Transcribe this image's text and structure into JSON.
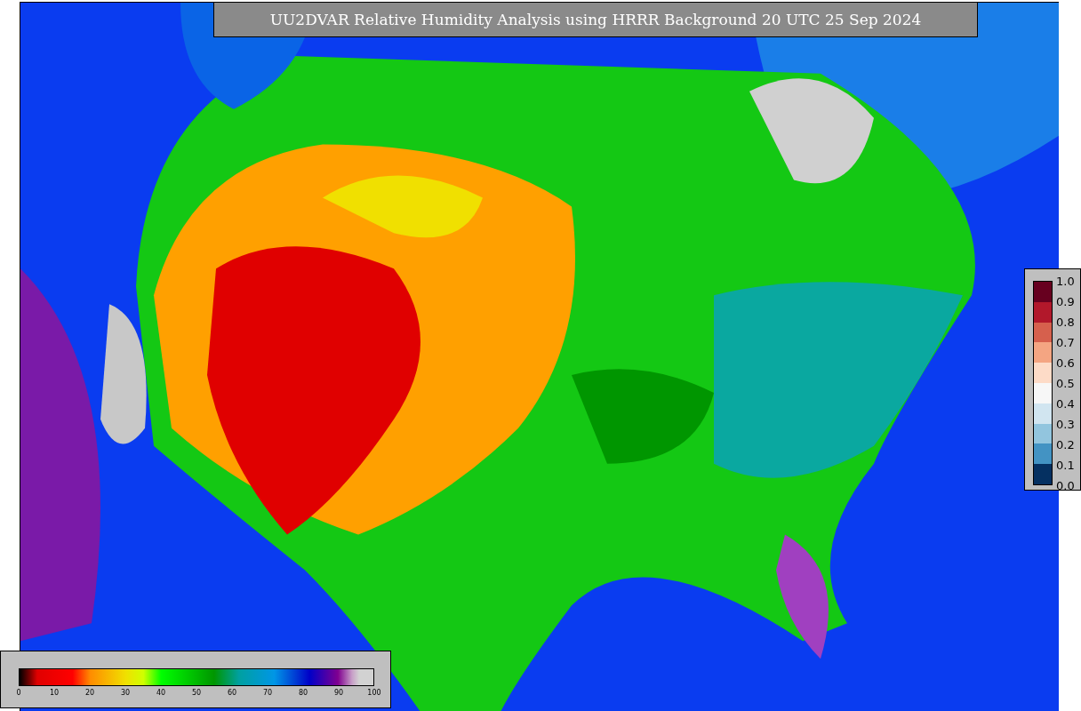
{
  "title": "UU2DVAR Relative Humidity Analysis using HRRR Background 20 UTC 25 Sep 2024",
  "quality_legend": {
    "ticks": [
      "1.0",
      "0.9",
      "0.8",
      "0.7",
      "0.6",
      "0.5",
      "0.4",
      "0.3",
      "0.2",
      "0.1",
      "0.0"
    ]
  },
  "humidity_legend": {
    "ticks": [
      "0",
      "10",
      "20",
      "30",
      "40",
      "50",
      "60",
      "70",
      "80",
      "90",
      "100"
    ]
  }
}
